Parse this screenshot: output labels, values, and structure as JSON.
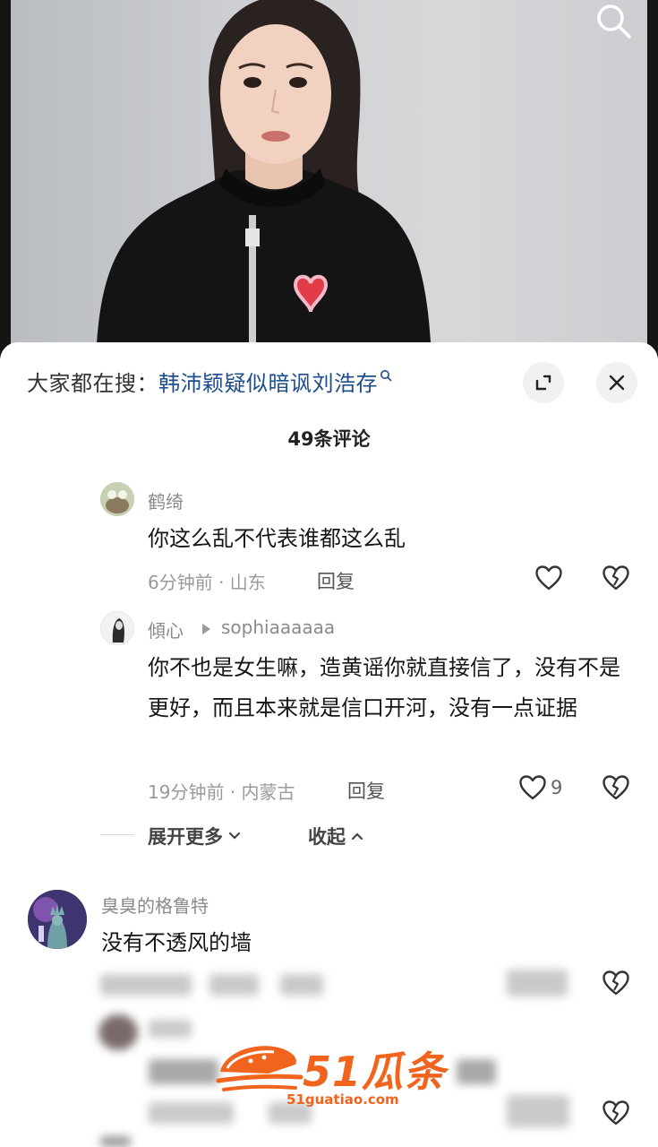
{
  "search_hint": {
    "prefix": "大家都在搜：",
    "query": "韩沛颖疑似暗讽刘浩存"
  },
  "comments_count": "49条评论",
  "comments": [
    {
      "user": "鹤绮",
      "text": "你这么乱不代表谁都这么乱",
      "meta": "6分钟前 · 山东",
      "reply_label": "回复"
    },
    {
      "user": "傾心",
      "reply_to": "sophiaaaaaa",
      "text": "你不也是女生嘛，造黄谣你就直接信了，没有不是更好，而且本来就是信口开河，没有一点证据",
      "meta": "19分钟前 · 内蒙古",
      "reply_label": "回复",
      "likes": "9"
    },
    {
      "user": "臭臭的格鲁特",
      "text": "没有不透风的墙"
    }
  ],
  "thread_controls": {
    "expand_label": "展开更多",
    "collapse_label": "收起"
  },
  "watermark": {
    "brand": "51瓜条",
    "url": "51guatiao.com"
  },
  "colors": {
    "search_query": "#1e4d8c",
    "watermark": "#f0641e"
  },
  "icons": [
    "search-icon",
    "expand-icon",
    "close-icon",
    "heart-icon",
    "broken-heart-icon",
    "chevron-down-icon",
    "chevron-up-icon",
    "play-arrow-icon"
  ]
}
